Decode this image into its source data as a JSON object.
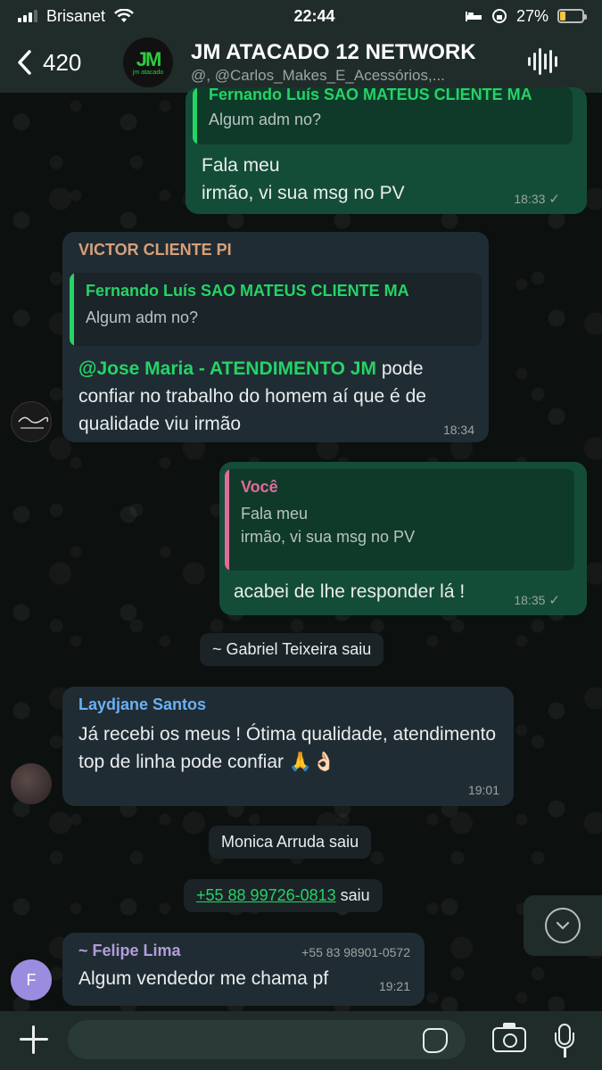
{
  "status_bar": {
    "carrier": "Brisanet",
    "time": "22:44",
    "battery": "27%",
    "battery_level": 0.27
  },
  "header": {
    "back_count": "420",
    "title": "JM ATACADO 12 NETWORK",
    "subtitle": "@, @Carlos_Makes_E_Acessórios,...",
    "avatar_text": "jm atacado",
    "avatar_mark": "JM"
  },
  "messages": [
    {
      "id": "m1",
      "direction": "out",
      "quote_name": "Fernando Luís SAO MATEUS CLIENTE MA",
      "quote_text": "Algum adm no?",
      "text": "Fala meu\nirmão, vi sua msg no PV",
      "time": "18:33",
      "status": "✓"
    },
    {
      "id": "m2",
      "direction": "in",
      "sender": "VICTOR CLIENTE PI",
      "sender_color": "#d8a07a",
      "quote_name": "Fernando Luís SAO MATEUS CLIENTE MA",
      "quote_text": "Algum adm no?",
      "mention": "@Jose Maria - ATENDIMENTO JM",
      "text_after_mention": " pode confiar no trabalho do homem aí que é de qualidade viu irmão",
      "time": "18:34"
    },
    {
      "id": "m3",
      "direction": "out",
      "quote_name": "Você",
      "quote_text": "Fala meu\nirmão, vi sua msg no PV",
      "text": "acabei de lhe responder lá !",
      "time": "18:35",
      "status": "✓"
    },
    {
      "id": "s1",
      "type": "system",
      "text": "~ Gabriel Teixeira saiu"
    },
    {
      "id": "m4",
      "direction": "in",
      "sender": "Laydjane Santos",
      "sender_color": "#6ab0f3",
      "text": "Já recebi os meus ! Ótima qualidade, atendimento top de linha pode confiar 🙏👌🏻",
      "time": "19:01"
    },
    {
      "id": "s2",
      "type": "system",
      "text": "Monica Arruda saiu"
    },
    {
      "id": "s3",
      "type": "system",
      "phone": "+55 88 99726-0813",
      "text": "saiu"
    },
    {
      "id": "m5",
      "direction": "in",
      "sender": "~ Felipe Lima",
      "sender_color": "#b39ddb",
      "sender_phone": "+55 83 98901-0572",
      "avatar_letter": "F",
      "text": "Algum vendedor me chama pf",
      "time": "19:21"
    }
  ],
  "input": {
    "placeholder": ""
  },
  "colors": {
    "outgoing_bubble": "#144d37",
    "incoming_bubble": "#202c33",
    "accent_green": "#25d366"
  },
  "icons": {
    "back": "chevron-left-icon",
    "voice_chat": "waveform-icon",
    "scroll_down": "chevron-down-circle-icon",
    "attach": "plus-icon",
    "sticker": "sticker-icon",
    "camera": "camera-icon",
    "mic": "microphone-icon"
  }
}
